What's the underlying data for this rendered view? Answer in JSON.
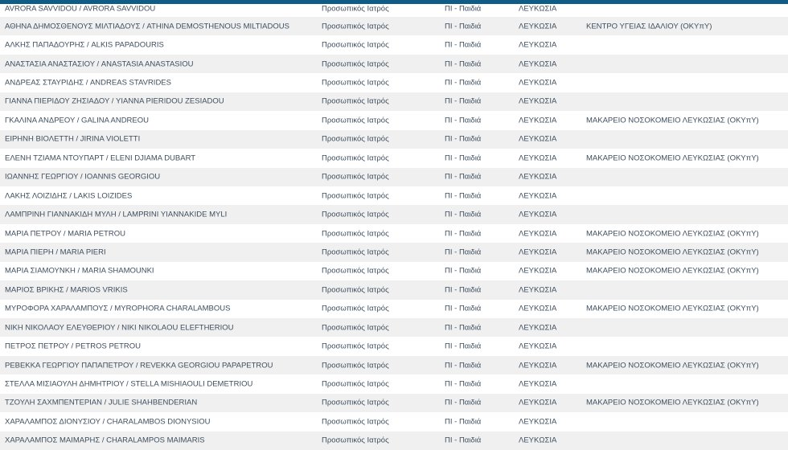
{
  "rows": [
    {
      "name": "AVRORA SAVVIDOU / AVRORA SAVVIDOU",
      "type": "Προσωπικός Ιατρός",
      "specialty": "ΠΙ - Παιδιά",
      "district": "ΛΕΥΚΩΣΙΑ",
      "facility": ""
    },
    {
      "name": "ΑΘΗΝΑ ΔΗΜΟΣΘΕΝΟΥΣ ΜΙΛΤΙΑΔΟΥΣ / ATHINA DEMOSTHENOUS MILTIADOUS",
      "type": "Προσωπικός Ιατρός",
      "specialty": "ΠΙ - Παιδιά",
      "district": "ΛΕΥΚΩΣΙΑ",
      "facility": "ΚΕΝΤΡΟ ΥΓΕΙΑΣ ΙΔΑΛΙΟΥ (ΟΚΥπΥ)"
    },
    {
      "name": "ΑΛΚΗΣ ΠΑΠΑΔΟΥΡΗΣ / ALKIS PAPADOURIS",
      "type": "Προσωπικός Ιατρός",
      "specialty": "ΠΙ - Παιδιά",
      "district": "ΛΕΥΚΩΣΙΑ",
      "facility": ""
    },
    {
      "name": "ΑΝΑΣΤΑΣΙΑ ΑΝΑΣΤΑΣΙΟΥ / ANASTASIA ANASTASIOU",
      "type": "Προσωπικός Ιατρός",
      "specialty": "ΠΙ - Παιδιά",
      "district": "ΛΕΥΚΩΣΙΑ",
      "facility": ""
    },
    {
      "name": "ΑΝΔΡΕΑΣ ΣΤΑΥΡΙΔΗΣ / ANDREAS STAVRIDES",
      "type": "Προσωπικός Ιατρός",
      "specialty": "ΠΙ - Παιδιά",
      "district": "ΛΕΥΚΩΣΙΑ",
      "facility": ""
    },
    {
      "name": "ΓΙΑΝΝΑ ΠΙΕΡΙΔΟΥ ΖΗΣΙΑΔΟΥ / YIANNA PIERIDOU ZESIADOU",
      "type": "Προσωπικός Ιατρός",
      "specialty": "ΠΙ - Παιδιά",
      "district": "ΛΕΥΚΩΣΙΑ",
      "facility": ""
    },
    {
      "name": "ΓΚΑΛΙΝΑ ΑΝΔΡΕΟΥ / GALINA ANDREOU",
      "type": "Προσωπικός Ιατρός",
      "specialty": "ΠΙ - Παιδιά",
      "district": "ΛΕΥΚΩΣΙΑ",
      "facility": "ΜΑΚΑΡΕΙΟ ΝΟΣΟΚΟΜΕΙΟ ΛΕΥΚΩΣΙΑΣ (ΟΚΥπΥ)"
    },
    {
      "name": "ΕΙΡΗΝΗ ΒΙΟΛΕΤΤΗ / JIRINA VIOLETTI",
      "type": "Προσωπικός Ιατρός",
      "specialty": "ΠΙ - Παιδιά",
      "district": "ΛΕΥΚΩΣΙΑ",
      "facility": ""
    },
    {
      "name": "ΕΛΕΝΗ ΤΖΙΑΜΑ ΝΤΟΥΠΑΡΤ / ELENI DJIAMA DUBART",
      "type": "Προσωπικός Ιατρός",
      "specialty": "ΠΙ - Παιδιά",
      "district": "ΛΕΥΚΩΣΙΑ",
      "facility": "ΜΑΚΑΡΕΙΟ ΝΟΣΟΚΟΜΕΙΟ ΛΕΥΚΩΣΙΑΣ (ΟΚΥπΥ)"
    },
    {
      "name": "ΙΩΑΝΝΗΣ ΓΕΩΡΓΙΟΥ / IOANNIS GEORGIOU",
      "type": "Προσωπικός Ιατρός",
      "specialty": "ΠΙ - Παιδιά",
      "district": "ΛΕΥΚΩΣΙΑ",
      "facility": ""
    },
    {
      "name": "ΛΑΚΗΣ ΛΟΙΖΙΔΗΣ / LAKIS LOIZIDES",
      "type": "Προσωπικός Ιατρός",
      "specialty": "ΠΙ - Παιδιά",
      "district": "ΛΕΥΚΩΣΙΑ",
      "facility": ""
    },
    {
      "name": "ΛΑΜΠΡΙΝΗ ΓΙΑΝΝΑΚΙΔΗ ΜΥΛΗ / LAMPRINI YIANNAKIDE MYLI",
      "type": "Προσωπικός Ιατρός",
      "specialty": "ΠΙ - Παιδιά",
      "district": "ΛΕΥΚΩΣΙΑ",
      "facility": ""
    },
    {
      "name": "ΜΑΡΙΑ ΠΕΤΡΟΥ / MARIA PETROU",
      "type": "Προσωπικός Ιατρός",
      "specialty": "ΠΙ - Παιδιά",
      "district": "ΛΕΥΚΩΣΙΑ",
      "facility": "ΜΑΚΑΡΕΙΟ ΝΟΣΟΚΟΜΕΙΟ ΛΕΥΚΩΣΙΑΣ (ΟΚΥπΥ)"
    },
    {
      "name": "ΜΑΡΙΑ ΠΙΕΡΗ / MARIA PIERI",
      "type": "Προσωπικός Ιατρός",
      "specialty": "ΠΙ - Παιδιά",
      "district": "ΛΕΥΚΩΣΙΑ",
      "facility": "ΜΑΚΑΡΕΙΟ ΝΟΣΟΚΟΜΕΙΟ ΛΕΥΚΩΣΙΑΣ (ΟΚΥπΥ)"
    },
    {
      "name": "ΜΑΡΙΑ ΣΙΑΜΟΥΝΚΗ / MARIA SHAMOUNKI",
      "type": "Προσωπικός Ιατρός",
      "specialty": "ΠΙ - Παιδιά",
      "district": "ΛΕΥΚΩΣΙΑ",
      "facility": "ΜΑΚΑΡΕΙΟ ΝΟΣΟΚΟΜΕΙΟ ΛΕΥΚΩΣΙΑΣ (ΟΚΥπΥ)"
    },
    {
      "name": "ΜΑΡΙΟΣ ΒΡΙΚΗΣ / MARIOS VRIKIS",
      "type": "Προσωπικός Ιατρός",
      "specialty": "ΠΙ - Παιδιά",
      "district": "ΛΕΥΚΩΣΙΑ",
      "facility": ""
    },
    {
      "name": "ΜΥΡΟΦΟΡΑ ΧΑΡΑΛΑΜΠΟΥΣ / MYROPHORA CHARALAMBOUS",
      "type": "Προσωπικός Ιατρός",
      "specialty": "ΠΙ - Παιδιά",
      "district": "ΛΕΥΚΩΣΙΑ",
      "facility": "ΜΑΚΑΡΕΙΟ ΝΟΣΟΚΟΜΕΙΟ ΛΕΥΚΩΣΙΑΣ (ΟΚΥπΥ)"
    },
    {
      "name": "ΝΙΚΗ ΝΙΚΟΛΑΟΥ ΕΛΕΥΘΕΡΙΟΥ / NIKI NIKOLAOU ELEFTHERIOU",
      "type": "Προσωπικός Ιατρός",
      "specialty": "ΠΙ - Παιδιά",
      "district": "ΛΕΥΚΩΣΙΑ",
      "facility": ""
    },
    {
      "name": "ΠΕΤΡΟΣ ΠΕΤΡΟΥ / PETROS PETROU",
      "type": "Προσωπικός Ιατρός",
      "specialty": "ΠΙ - Παιδιά",
      "district": "ΛΕΥΚΩΣΙΑ",
      "facility": ""
    },
    {
      "name": "ΡΕΒΕΚΚΑ ΓΕΩΡΓΙΟΥ ΠΑΠΑΠΕΤΡΟΥ / REVEKKA GEORGIOU PAPAPETROU",
      "type": "Προσωπικός Ιατρός",
      "specialty": "ΠΙ - Παιδιά",
      "district": "ΛΕΥΚΩΣΙΑ",
      "facility": "ΜΑΚΑΡΕΙΟ ΝΟΣΟΚΟΜΕΙΟ ΛΕΥΚΩΣΙΑΣ (ΟΚΥπΥ)"
    },
    {
      "name": "ΣΤΕΛΛΑ ΜΙΣΙΑΟΥΛΗ ΔΗΜΗΤΡΙΟΥ / STELLA MISHIAOULI DEMETRIOU",
      "type": "Προσωπικός Ιατρός",
      "specialty": "ΠΙ - Παιδιά",
      "district": "ΛΕΥΚΩΣΙΑ",
      "facility": ""
    },
    {
      "name": "ΤΖΟΥΛΗ ΣΑΧΜΠΕΝΤΕΡΙΑΝ / JULIE SHAHBENDERIAN",
      "type": "Προσωπικός Ιατρός",
      "specialty": "ΠΙ - Παιδιά",
      "district": "ΛΕΥΚΩΣΙΑ",
      "facility": "ΜΑΚΑΡΕΙΟ ΝΟΣΟΚΟΜΕΙΟ ΛΕΥΚΩΣΙΑΣ (ΟΚΥπΥ)"
    },
    {
      "name": "ΧΑΡΑΛΑΜΠΟΣ ΔΙΟΝΥΣΙΟΥ / CHARALAMBOS DIONYSIOU",
      "type": "Προσωπικός Ιατρός",
      "specialty": "ΠΙ - Παιδιά",
      "district": "ΛΕΥΚΩΣΙΑ",
      "facility": ""
    },
    {
      "name": "ΧΑΡΑΛΑΜΠΟΣ ΜΑΙΜΑΡΗΣ / CHARALAMPOS MAIMARIS",
      "type": "Προσωπικός Ιατρός",
      "specialty": "ΠΙ - Παιδιά",
      "district": "ΛΕΥΚΩΣΙΑ",
      "facility": ""
    }
  ]
}
